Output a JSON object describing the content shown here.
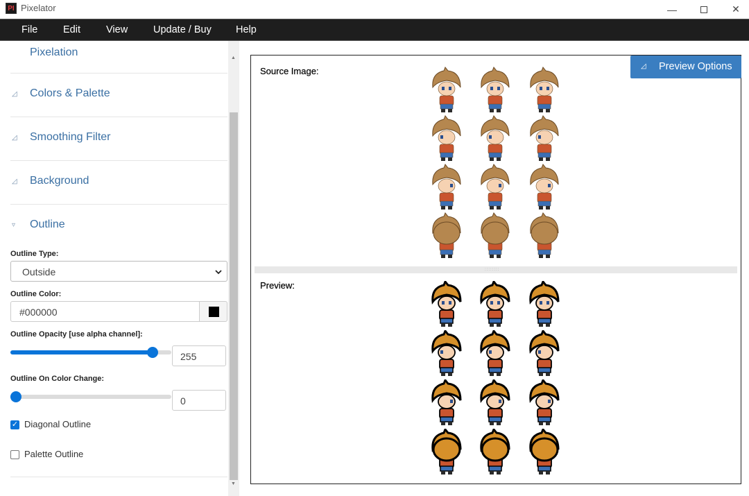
{
  "window": {
    "title": "Pixelator",
    "icon_text": "PI",
    "minimize_glyph": "—",
    "close_glyph": "✕"
  },
  "menu": {
    "items": [
      "File",
      "Edit",
      "View",
      "Update / Buy",
      "Help"
    ]
  },
  "left_panel": {
    "partial_section": "Pixelation",
    "sections": [
      {
        "label": "Colors & Palette",
        "icon": "collapsed-triangle-icon",
        "glyph": "◿"
      },
      {
        "label": "Smoothing Filter",
        "icon": "collapsed-triangle-icon",
        "glyph": "◿"
      },
      {
        "label": "Background",
        "icon": "collapsed-triangle-icon",
        "glyph": "◿"
      },
      {
        "label": "Outline",
        "icon": "expanded-triangle-icon",
        "glyph": "▿"
      }
    ],
    "outline": {
      "type_label": "Outline Type:",
      "type_value": "Outside",
      "color_label": "Outline Color:",
      "color_value": "#000000",
      "opacity_label": "Outline Opacity [use alpha channel]:",
      "opacity_value": "255",
      "opacity_fraction": 0.914,
      "on_color_change_label": "Outline On Color Change:",
      "on_color_change_value": "0",
      "on_color_change_fraction": 0.0,
      "diagonal_label": "Diagonal Outline",
      "diagonal_checked": true,
      "palette_label": "Palette Outline",
      "palette_checked": false
    }
  },
  "right_panel": {
    "source_label": "Source Image:",
    "preview_label": "Preview:",
    "preview_options_label": "Preview Options",
    "sprite_rows": 4,
    "sprite_cols": 3
  },
  "colors": {
    "accent": "#3a7ec1",
    "slider_blue": "#0a74d9",
    "section_link": "#3a6fa3",
    "menubar": "#1e1e1e",
    "hair": "#b5874f",
    "hair_preview": "#d6902a",
    "skin": "#f6d2b2",
    "shirt": "#c9552f",
    "pants": "#3b6fb5"
  }
}
